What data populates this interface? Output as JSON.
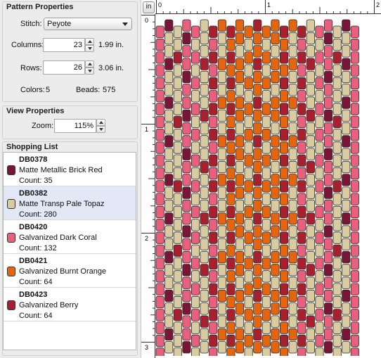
{
  "pattern_properties": {
    "title": "Pattern Properties",
    "stitch_label": "Stitch:",
    "stitch_value": "Peyote",
    "columns_label": "Columns:",
    "columns_value": "23",
    "columns_inches": "1.99 in.",
    "rows_label": "Rows:",
    "rows_value": "26",
    "rows_inches": "3.06 in.",
    "colors_label": "Colors:",
    "colors_value": "5",
    "beads_label": "Beads:",
    "beads_value": "575"
  },
  "view_properties": {
    "title": "View Properties",
    "zoom_label": "Zoom:",
    "zoom_value": "115%"
  },
  "shopping_list": {
    "title": "Shopping List",
    "count_prefix": "Count:",
    "items": [
      {
        "code": "DB0378",
        "name": "Matte Metallic Brick Red",
        "count": "35",
        "color": "#7a1535",
        "selected": false
      },
      {
        "code": "DB0382",
        "name": "Matte Transp Pale Topaz",
        "count": "280",
        "color": "#d9cba0",
        "selected": true
      },
      {
        "code": "DB0420",
        "name": "Galvanized Dark Coral",
        "count": "132",
        "color": "#e8607c",
        "selected": false
      },
      {
        "code": "DB0421",
        "name": "Galvanized Burnt Orange",
        "count": "64",
        "color": "#e5650f",
        "selected": false
      },
      {
        "code": "DB0423",
        "name": "Galvanized Berry",
        "count": "64",
        "color": "#a81f2e",
        "selected": false
      }
    ]
  },
  "canvas": {
    "unit_button": "in",
    "ruler_top_labels": [
      "0",
      "1",
      "2"
    ],
    "ruler_left_labels": [
      "0",
      "1",
      "2",
      "3"
    ]
  }
}
